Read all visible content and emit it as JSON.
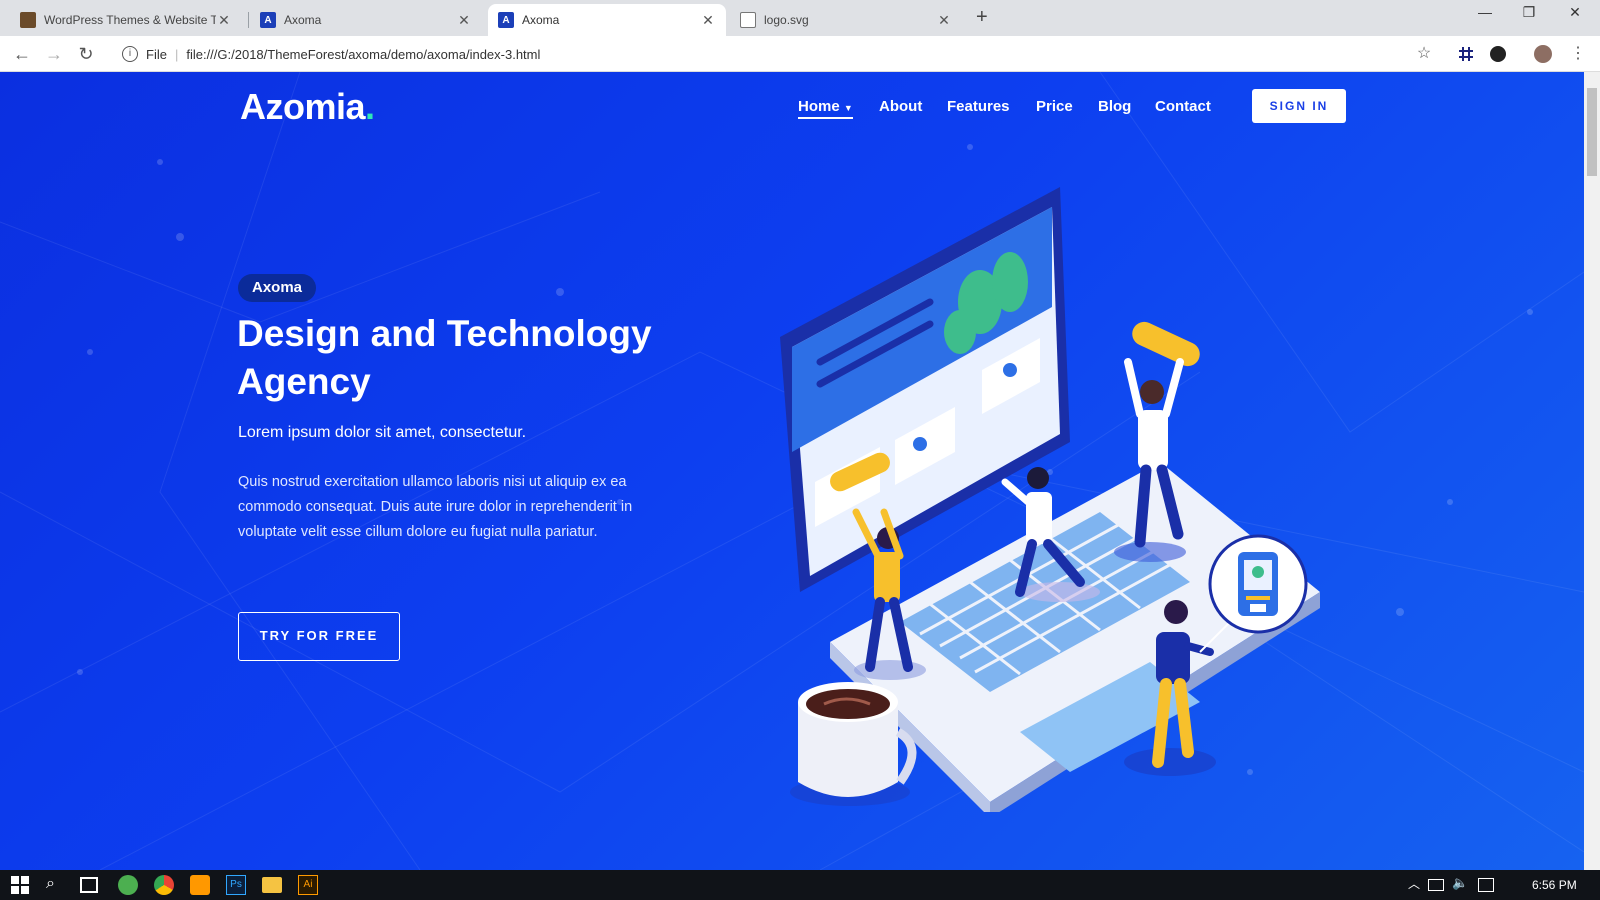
{
  "browser": {
    "tabs": [
      {
        "title": "WordPress Themes & Website Te",
        "favicon": "envato-icon",
        "active": false
      },
      {
        "title": "Axoma",
        "favicon": "A",
        "active": false
      },
      {
        "title": "Axoma",
        "favicon": "A",
        "active": true
      },
      {
        "title": "logo.svg",
        "favicon": "file-icon",
        "active": false
      }
    ],
    "new_tab": "+",
    "address": {
      "security_label": "File",
      "url": "file:///G:/2018/ThemeForest/axoma/demo/axoma/index-3.html"
    }
  },
  "site": {
    "logo": "Azomia",
    "logo_dot": ".",
    "nav": [
      "Home",
      "About",
      "Features",
      "Price",
      "Blog",
      "Contact"
    ],
    "signin": "SIGN IN"
  },
  "hero": {
    "badge": "Axoma",
    "title": "Design and Technology Agency",
    "lead": "Lorem ipsum dolor sit amet, consectetur.",
    "body": "Quis nostrud exercitation ullamco laboris nisi ut aliquip ex ea commodo consequat. Duis aute irure dolor in reprehenderit in voluptate velit esse cillum dolore eu fugiat nulla pariatur.",
    "cta": "TRY FOR FREE"
  },
  "taskbar": {
    "clock": "6:56 PM"
  },
  "colors": {
    "page_bg_start": "#0b2fe0",
    "page_bg_end": "#1662f0",
    "logo_dot": "#2ee8b6",
    "badge_bg": "#0b2b9a"
  }
}
